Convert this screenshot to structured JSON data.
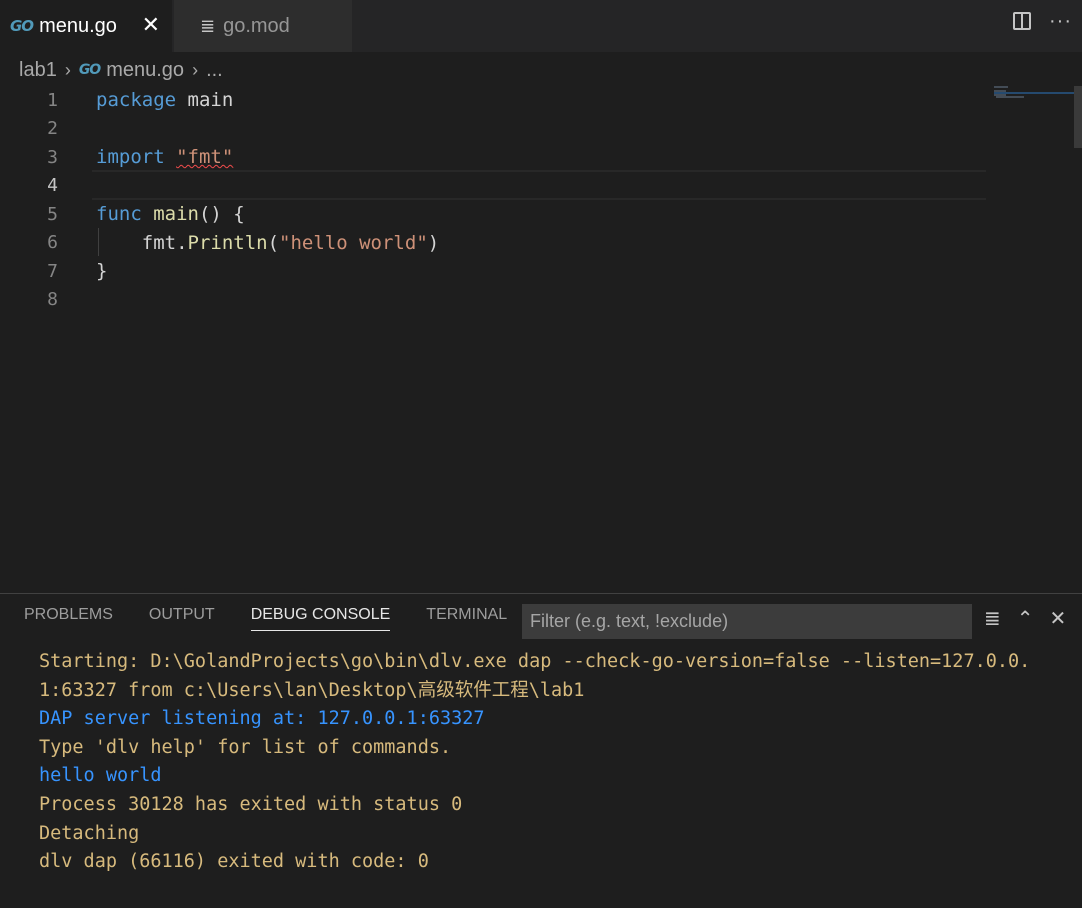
{
  "tabs": [
    {
      "label": "menu.go",
      "icon": "go-file-icon",
      "active": true
    },
    {
      "label": "go.mod",
      "icon": "file-lines-icon",
      "active": false
    }
  ],
  "go_icon_text": "GO",
  "breadcrumb": {
    "folder": "lab1",
    "file": "menu.go",
    "ellipsis": "..."
  },
  "editor": {
    "line_numbers": [
      "1",
      "2",
      "3",
      "4",
      "5",
      "6",
      "7",
      "8"
    ],
    "current_line": "4",
    "lines": [
      {
        "tokens": [
          {
            "t": "kw",
            "v": "package"
          },
          {
            "t": "id",
            "v": " main"
          }
        ]
      },
      {
        "tokens": []
      },
      {
        "tokens": [
          {
            "t": "kw",
            "v": "import"
          },
          {
            "t": "id",
            "v": " "
          },
          {
            "t": "str",
            "v": "\"fmt\""
          }
        ]
      },
      {
        "tokens": []
      },
      {
        "tokens": [
          {
            "t": "kw",
            "v": "func"
          },
          {
            "t": "id",
            "v": " "
          },
          {
            "t": "fn",
            "v": "main"
          },
          {
            "t": "id",
            "v": "() {"
          }
        ]
      },
      {
        "tokens": [
          {
            "t": "id",
            "v": "    fmt."
          },
          {
            "t": "fn",
            "v": "Println"
          },
          {
            "t": "id",
            "v": "("
          },
          {
            "t": "str",
            "v": "\"hello world\""
          },
          {
            "t": "id",
            "v": ")"
          }
        ]
      },
      {
        "tokens": [
          {
            "t": "id",
            "v": "}"
          }
        ]
      },
      {
        "tokens": []
      }
    ]
  },
  "panel": {
    "tabs": [
      "PROBLEMS",
      "OUTPUT",
      "DEBUG CONSOLE",
      "TERMINAL"
    ],
    "active_tab": "DEBUG CONSOLE",
    "filter_placeholder": "Filter (e.g. text, !exclude)",
    "console_lines": [
      {
        "color": "orange",
        "text": "Starting: D:\\GolandProjects\\go\\bin\\dlv.exe dap --check-go-version=false --listen=127.0.0."
      },
      {
        "color": "orange",
        "text": "1:63327 from c:\\Users\\lan\\Desktop\\高级软件工程\\lab1"
      },
      {
        "color": "blue",
        "text": "DAP server listening at: 127.0.0.1:63327"
      },
      {
        "color": "orange",
        "text": "Type 'dlv help' for list of commands."
      },
      {
        "color": "blue",
        "text": "hello world"
      },
      {
        "color": "orange",
        "text": "Process 30128 has exited with status 0"
      },
      {
        "color": "orange",
        "text": "Detaching"
      },
      {
        "color": "orange",
        "text": "dlv dap (66116) exited with code: 0"
      }
    ]
  },
  "colors": {
    "keyword": "#569cd6",
    "string": "#ce9178",
    "function": "#dcdcaa",
    "console_orange": "#d7ba7d",
    "console_blue": "#3794ff"
  }
}
